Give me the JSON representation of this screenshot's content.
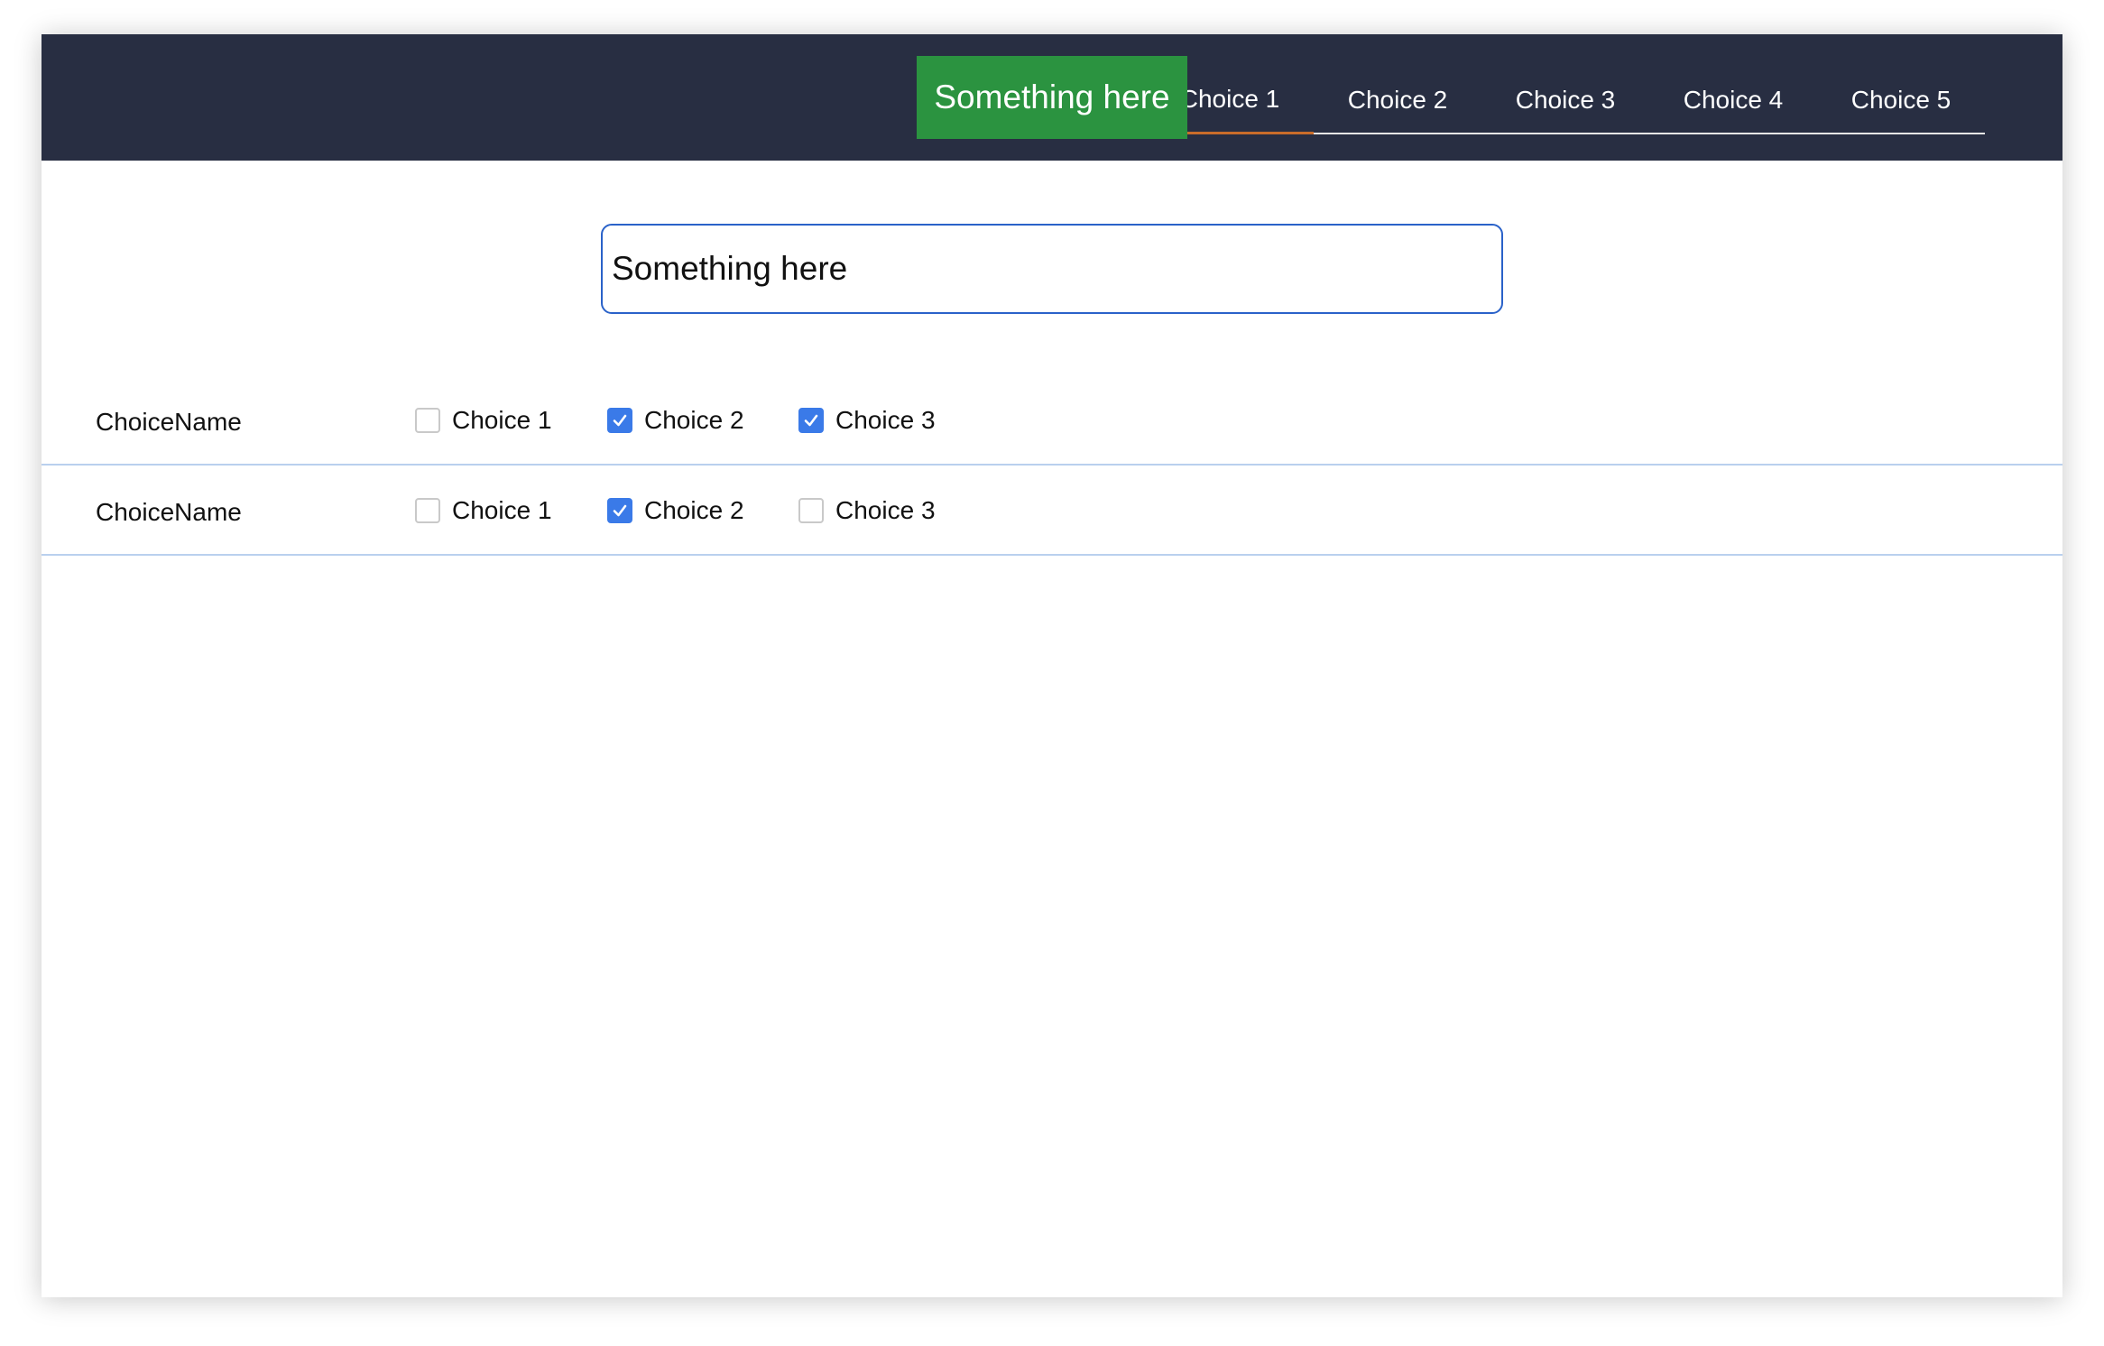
{
  "tabs": [
    "Choice 1",
    "Choice 2",
    "Choice 3",
    "Choice 4",
    "Choice 5"
  ],
  "active_tab": 0,
  "overlay_button": {
    "label": "Something here",
    "color": "#2b9340"
  },
  "search": {
    "value": "Something here"
  },
  "rows": [
    {
      "label": "ChoiceName",
      "options": [
        {
          "label": "Choice 1",
          "checked": false
        },
        {
          "label": "Choice 2",
          "checked": true
        },
        {
          "label": "Choice 3",
          "checked": true
        }
      ]
    },
    {
      "label": "ChoiceName",
      "options": [
        {
          "label": "Choice 1",
          "checked": false
        },
        {
          "label": "Choice 2",
          "checked": true
        },
        {
          "label": "Choice 3",
          "checked": false
        }
      ]
    }
  ],
  "colors": {
    "topbar": "#282e42",
    "accent": "#3a7ae8",
    "active_tab_underline": "#c96c2a"
  }
}
